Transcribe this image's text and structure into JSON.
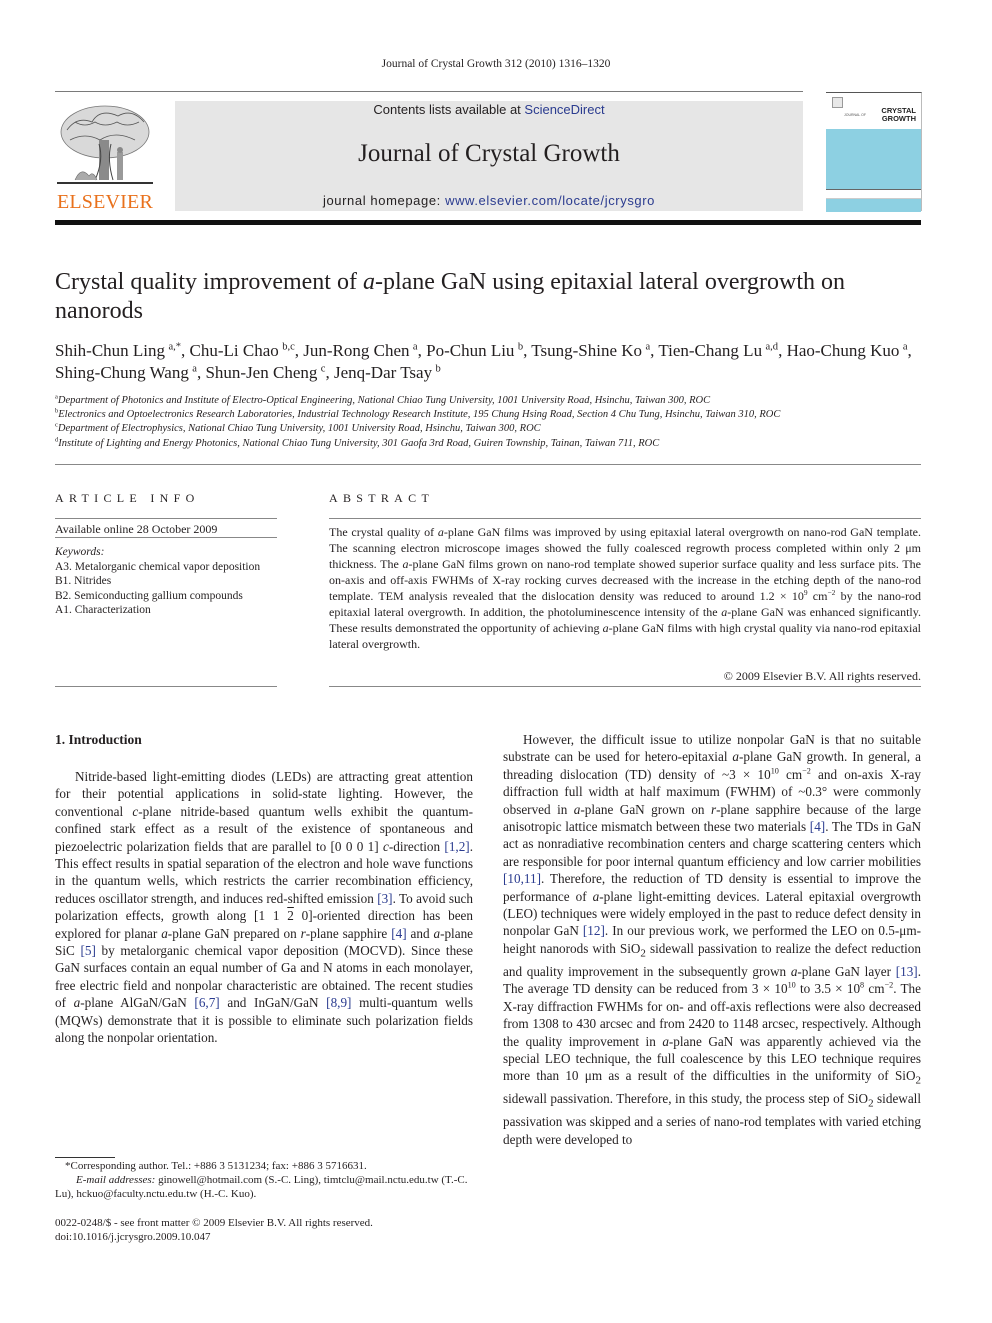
{
  "running_head": "Journal of Crystal Growth 312 (2010) 1316–1320",
  "header": {
    "publisher_logo": "elsevier-tree-logo",
    "publisher_name": "ELSEVIER",
    "contents_prefix": "Contents lists available at ",
    "contents_link": "ScienceDirect",
    "journal_name": "Journal of Crystal Growth",
    "homepage_prefix": "journal homepage: ",
    "homepage_link": "www.elsevier.com/locate/jcrysgro",
    "cover_title_line1": "CRYSTAL",
    "cover_title_line2": "GROWTH",
    "cover_kicker": "JOURNAL OF",
    "colors": {
      "logo_orange": "#e9711c",
      "link_blue": "#2a3b8f",
      "header_gray": "#e6e6e6",
      "cover_cyan": "#8dd0e2"
    }
  },
  "article": {
    "title_part1": "Crystal quality improvement of ",
    "title_italic": "a",
    "title_part2": "-plane GaN using epitaxial lateral overgrowth on nanorods",
    "authors": [
      {
        "name": "Shih-Chun Ling",
        "aff": "a,*",
        "sep": ", "
      },
      {
        "name": "Chu-Li Chao",
        "aff": "b,c",
        "sep": ", "
      },
      {
        "name": "Jun-Rong Chen",
        "aff": "a",
        "sep": ", "
      },
      {
        "name": "Po-Chun Liu",
        "aff": "b",
        "sep": ", "
      },
      {
        "name": "Tsung-Shine Ko",
        "aff": "a",
        "sep": ", "
      },
      {
        "name": "Tien-Chang Lu",
        "aff": "a,d",
        "sep": ", "
      },
      {
        "name": "Hao-Chung Kuo",
        "aff": "a",
        "sep": ", "
      },
      {
        "name": "Shing-Chung Wang",
        "aff": "a",
        "sep": ", "
      },
      {
        "name": "Shun-Jen Cheng",
        "aff": "c",
        "sep": ", "
      },
      {
        "name": "Jenq-Dar Tsay",
        "aff": "b",
        "sep": ""
      }
    ],
    "affiliations": [
      {
        "key": "a",
        "text": "Department of Photonics and Institute of Electro-Optical Engineering, National Chiao Tung University, 1001 University Road, Hsinchu, Taiwan 300, ROC"
      },
      {
        "key": "b",
        "text": "Electronics and Optoelectronics Research Laboratories, Industrial Technology Research Institute, 195 Chung Hsing Road, Section 4 Chu Tung, Hsinchu, Taiwan 310, ROC"
      },
      {
        "key": "c",
        "text": "Department of Electrophysics, National Chiao Tung University, 1001 University Road, Hsinchu, Taiwan 300, ROC"
      },
      {
        "key": "d",
        "text": "Institute of Lighting and Energy Photonics, National Chiao Tung University, 301 Gaofa 3rd Road, Guiren Township, Tainan, Taiwan 711, ROC"
      }
    ]
  },
  "article_info": {
    "label": "ARTICLE INFO",
    "available_online": "Available online 28 October 2009",
    "keywords_label": "Keywords:",
    "keywords": [
      "A3. Metalorganic chemical vapor deposition",
      "B1. Nitrides",
      "B2. Semiconducting gallium compounds",
      "A1. Characterization"
    ]
  },
  "abstract": {
    "label": "ABSTRACT",
    "s1a": "The crystal quality of ",
    "s1b": "-plane GaN films was improved by using epitaxial lateral overgrowth on nano-rod GaN template. The scanning electron microscope images showed the fully coalesced regrowth process completed within only 2 μm thickness. The ",
    "s1c": "-plane GaN films grown on nano-rod template showed superior surface quality and less surface pits. The on-axis and off-axis FWHMs of X-ray rocking curves decreased with the increase in the etching depth of the nano-rod template. TEM analysis revealed that the dislocation density was reduced to around 1.2 × 10",
    "exp1": "9",
    "s1d": " cm",
    "exp2": "−2",
    "s1e": " by the nano-rod epitaxial lateral overgrowth. In addition, the photoluminescence intensity of the ",
    "s1f": "-plane GaN was enhanced significantly. These results demonstrated the opportunity of achieving ",
    "s1g": "-plane GaN films with high crystal quality via nano-rod epitaxial lateral overgrowth.",
    "italic_a": "a",
    "copyright": "© 2009 Elsevier B.V. All rights reserved."
  },
  "introduction": {
    "heading": "1.  Introduction",
    "left_paragraph": {
      "t1": "Nitride-based light-emitting diodes (LEDs) are attracting great attention for their potential applications in solid-state lighting. However, the conventional ",
      "i1": "c",
      "t2": "-plane nitride-based quantum wells exhibit the quantum-confined stark effect as a result of the existence of spontaneous and piezoelectric polarization fields that are parallel to [0 0 0 1] ",
      "i2": "c",
      "t3": "-direction ",
      "r1": "[1,2]",
      "t4": ". This effect results in spatial separation of the electron and hole wave functions in the quantum wells, which restricts the carrier recombination efficiency, reduces oscillator strength, and induces red-shifted emission ",
      "r2": "[3]",
      "t5": ". To avoid such polarization effects, growth along [1 1 ",
      "overbar": "2",
      "t6": " 0]-oriented direction has been explored for planar ",
      "i3": "a",
      "t7": "-plane GaN prepared on ",
      "i4": "r",
      "t8": "-plane sapphire ",
      "r3": "[4]",
      "t9": " and ",
      "i5": "a",
      "t10": "-plane SiC ",
      "r4": "[5]",
      "t11": " by metalorganic chemical vapor deposition (MOCVD). Since these GaN surfaces contain an equal number of Ga and N atoms in each monolayer, free electric field and nonpolar characteristic are obtained. The recent studies of ",
      "i6": "a",
      "t12": "-plane AlGaN/GaN ",
      "r5": "[6,7]",
      "t13": " and InGaN/GaN ",
      "r6": "[8,9]",
      "t14": " multi-quantum wells (MQWs) demonstrate that it is possible to eliminate such polarization fields along the nonpolar orientation."
    },
    "right_paragraph": {
      "t1": "However, the difficult issue to utilize nonpolar GaN is that no suitable substrate can be used for hetero-epitaxial ",
      "i1": "a",
      "t2": "-plane GaN growth. In general, a threading dislocation (TD) density of ~3 × 10",
      "e1": "10",
      "t3": " cm",
      "e2": "−2",
      "t4": " and on-axis X-ray diffraction full width at half maximum (FWHM) of ~0.3° were commonly observed in ",
      "i2": "a",
      "t5": "-plane GaN grown on ",
      "i3": "r",
      "t6": "-plane sapphire because of the large anisotropic lattice mismatch between these two materials ",
      "r1": "[4]",
      "t7": ". The TDs in GaN act as nonradiative recombination centers and charge scattering centers which are responsible for poor internal quantum efficiency and low carrier mobilities ",
      "r2": "[10,11]",
      "t8": ". Therefore, the reduction of TD density is essential to improve the performance of ",
      "i4": "a",
      "t9": "-plane light-emitting devices. Lateral epitaxial overgrowth (LEO) techniques were widely employed in the past to reduce defect density in nonpolar GaN ",
      "r3": "[12]",
      "t10": ". In our previous work, we performed the LEO on 0.5-μm-height nanorods with SiO",
      "s1": "2",
      "t11": " sidewall passivation to realize the defect reduction and quality improvement in the subsequently grown ",
      "i5": "a",
      "t12": "-plane GaN layer ",
      "r4": "[13]",
      "t13": ". The average TD density can be reduced from 3 × 10",
      "e3": "10",
      "t14": " to 3.5 × 10",
      "e4": "8",
      "t15": " cm",
      "e5": "−2",
      "t16": ". The X-ray diffraction FWHMs for on- and off-axis reflections were also decreased from 1308 to 430 arcsec and from 2420 to 1148 arcsec, respectively. Although the quality improvement in ",
      "i6": "a",
      "t17": "-plane GaN was apparently achieved via the special LEO technique, the full coalescence by this LEO technique requires more than 10 μm as a result of the difficulties in the uniformity of SiO",
      "s2": "2",
      "t18": " sidewall passivation. Therefore, in this study, the process step of SiO",
      "s3": "2",
      "t19": " sidewall passivation was skipped and a series of nano-rod templates with varied etching depth were developed to"
    }
  },
  "footnotes": {
    "corresponding": "*Corresponding author. Tel.: +886 3 5131234; fax: +886 3 5716631.",
    "email_label": "E-mail addresses:",
    "emails": " ginowell@hotmail.com (S.-C. Ling), timtclu@mail.nctu.edu.tw (T.-C. Lu), hckuo@faculty.nctu.edu.tw (H.-C. Kuo).",
    "front_matter": "0022-0248/$ - see front matter © 2009 Elsevier B.V. All rights reserved.",
    "doi": "doi:10.1016/j.jcrysgro.2009.10.047"
  }
}
